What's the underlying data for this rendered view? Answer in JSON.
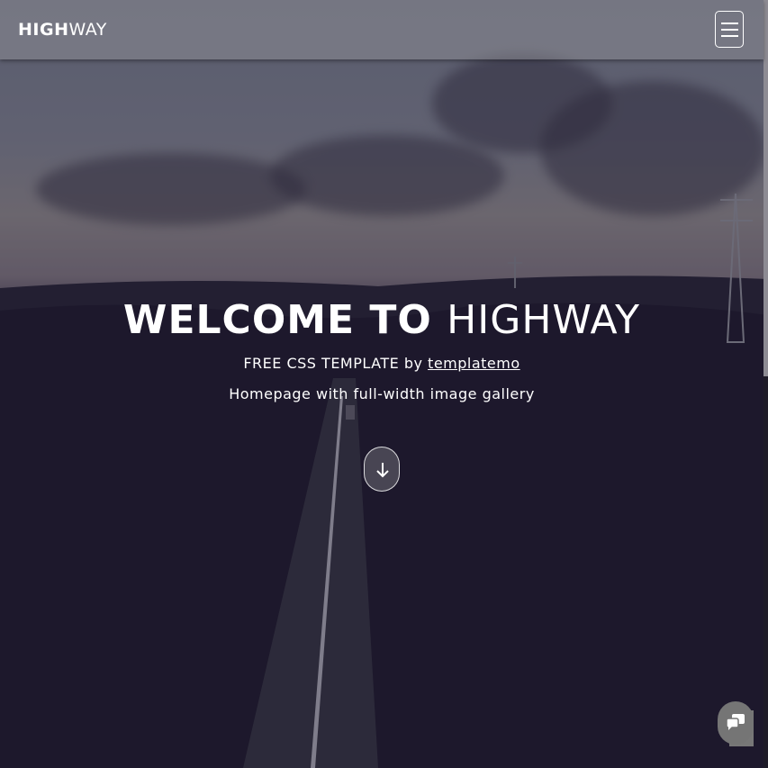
{
  "navbar": {
    "brand_bold": "HIGH",
    "brand_light": "WAY",
    "menu_icon": "hamburger-menu-icon"
  },
  "hero": {
    "title_bold": "WELCOME TO",
    "title_light": "HIGHWAY",
    "subtitle_prefix": "FREE CSS TEMPLATE by",
    "subtitle_link": "templatemo",
    "tagline": "Homepage with full-width image gallery",
    "scroll_icon": "arrow-down-icon"
  },
  "chat": {
    "icon": "chat-bubbles-icon"
  },
  "colors": {
    "overlay": "#14102880",
    "accent": "#ffffff"
  }
}
